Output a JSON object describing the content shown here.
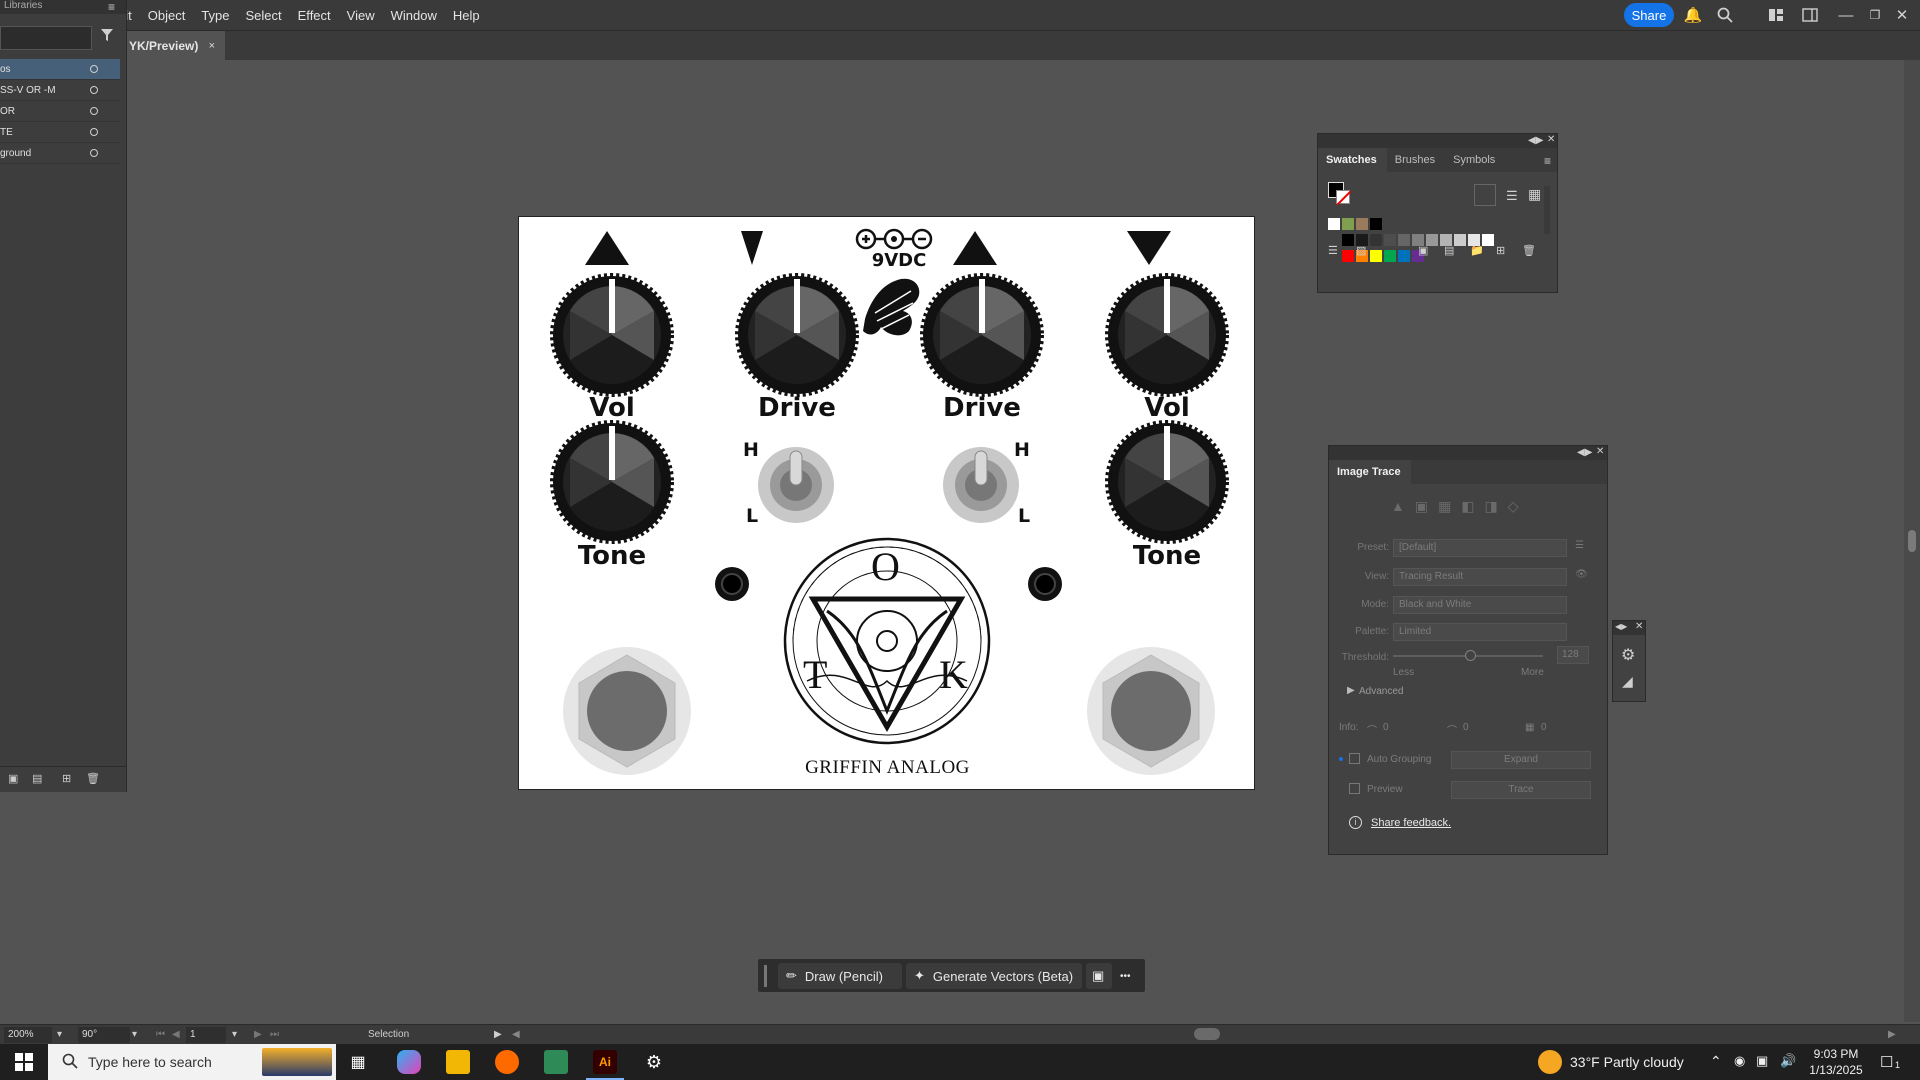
{
  "app": {
    "menu": [
      "dit",
      "Object",
      "Type",
      "Select",
      "Effect",
      "View",
      "Window",
      "Help"
    ],
    "share_label": "Share",
    "doc_tab": "YK/Preview)",
    "doc_tab_close": "×"
  },
  "layers_panel": {
    "title": "Libraries",
    "layers": [
      {
        "name": "os",
        "selected": true
      },
      {
        "name": "SS-V OR -M",
        "selected": false
      },
      {
        "name": "OR",
        "selected": false
      },
      {
        "name": "TE",
        "selected": false
      },
      {
        "name": "ground",
        "selected": false
      }
    ]
  },
  "artboard": {
    "knobs": {
      "vol_left": "Vol",
      "drive_left": "Drive",
      "drive_right": "Drive",
      "vol_right": "Vol",
      "tone_left": "Tone",
      "tone_right": "Tone"
    },
    "switch_labels": {
      "h_left": "H",
      "l_left": "L",
      "h_right": "H",
      "l_right": "L"
    },
    "power": "9VDC",
    "seal_letters": {
      "top": "O",
      "left": "T",
      "right": "K"
    },
    "brand": "GRIFFIN ANALOG"
  },
  "swatches_panel": {
    "tabs": [
      "Swatches",
      "Brushes",
      "Symbols"
    ],
    "active_tab": "Swatches",
    "row_gray": [
      "#000000",
      "#1a1a1a",
      "#333333",
      "#4d4d4d",
      "#666666",
      "#808080",
      "#999999",
      "#b3b3b3",
      "#cccccc",
      "#e6e6e6",
      "#ffffff"
    ],
    "row_color": [
      "#ff0000",
      "#ff7f00",
      "#ffff00",
      "#00a650",
      "#0072bc",
      "#662d91"
    ]
  },
  "image_trace_panel": {
    "title": "Image Trace",
    "preset_label": "Preset:",
    "preset_value": "[Default]",
    "view_label": "View:",
    "view_value": "Tracing Result",
    "mode_label": "Mode:",
    "mode_value": "Black and White",
    "palette_label": "Palette:",
    "palette_value": "Limited",
    "threshold_label": "Threshold:",
    "threshold_value": "128",
    "less": "Less",
    "more": "More",
    "advanced": "Advanced",
    "info_label": "Info:",
    "info_values": [
      "0",
      "0",
      "0"
    ],
    "auto_grouping": "Auto Grouping",
    "expand": "Expand",
    "preview": "Preview",
    "trace": "Trace",
    "feedback": "Share feedback."
  },
  "status_bar": {
    "zoom": "200%",
    "rotation": "90°",
    "artboard_num": "1",
    "tool": "Selection"
  },
  "context_bar": {
    "draw": "Draw (Pencil)",
    "generate": "Generate Vectors (Beta)",
    "more": "•••"
  },
  "taskbar": {
    "search_placeholder": "Type here to search",
    "weather": "33°F  Partly cloudy",
    "time": "9:03 PM",
    "date": "1/13/2025",
    "notif_count": "1"
  }
}
